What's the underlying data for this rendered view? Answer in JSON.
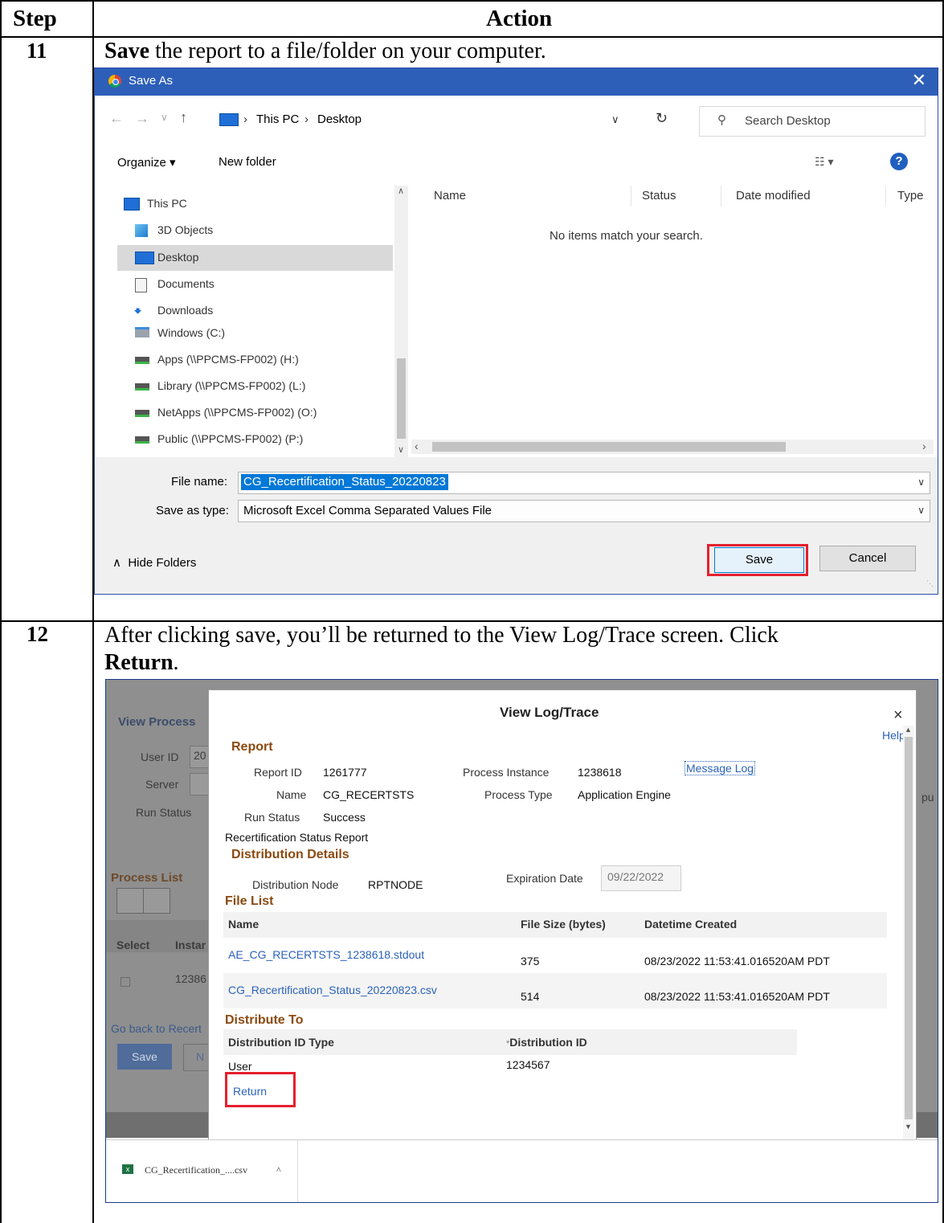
{
  "table": {
    "header_step": "Step",
    "header_action": "Action",
    "rows": [
      {
        "step": "11",
        "bold": "Save",
        "text": " the report to a file/folder on your computer."
      },
      {
        "step": "12",
        "text_line1": "After clicking save, you’ll be returned to the View Log/Trace screen. Click",
        "bold": "Return",
        "after": "."
      }
    ]
  },
  "save_as": {
    "title": "Save As",
    "close": "✕",
    "breadcrumb": [
      "This PC",
      "Desktop"
    ],
    "search_placeholder": "Search Desktop",
    "organize": "Organize ▾",
    "new_folder": "New folder",
    "nav_items": [
      "This PC",
      "3D Objects",
      "Desktop",
      "Documents",
      "Downloads",
      "Windows (C:)",
      "Apps (\\\\PPCMS-FP002) (H:)",
      "Library (\\\\PPCMS-FP002) (L:)",
      "NetApps (\\\\PPCMS-FP002) (O:)",
      "Public (\\\\PPCMS-FP002) (P:)"
    ],
    "columns": [
      "Name",
      "Status",
      "Date modified",
      "Type"
    ],
    "empty_message": "No items match your search.",
    "file_name_label": "File name:",
    "file_name_value": "CG_Recertification_Status_20220823",
    "save_type_label": "Save as type:",
    "save_type_value": "Microsoft Excel Comma Separated Values File",
    "hide_folders": "Hide Folders",
    "save": "Save",
    "cancel": "Cancel",
    "accent": "#2e5fb8"
  },
  "background": {
    "title": "View Process",
    "user_id": "User ID",
    "user_id_value": "20",
    "server": "Server",
    "run_status": "Run Status",
    "process_list": "Process List",
    "col_select": "Select",
    "col_instance": "Instar",
    "instance_value": "12386",
    "go_back": "Go back to Recert",
    "save": "Save",
    "n_btn": "N",
    "edge_text": "pu"
  },
  "view_log": {
    "title": "View Log/Trace",
    "close": "×",
    "help": "Help",
    "report_section": "Report",
    "report_id_label": "Report ID",
    "report_id": "1261777",
    "process_instance_label": "Process Instance",
    "process_instance": "1238618",
    "message_log": "Message Log",
    "name_label": "Name",
    "name": "CG_RECERTSTS",
    "process_type_label": "Process Type",
    "process_type": "Application Engine",
    "run_status_label": "Run Status",
    "run_status": "Success",
    "description": "Recertification Status Report",
    "distribution_section": "Distribution Details",
    "dist_node_label": "Distribution Node",
    "dist_node": "RPTNODE",
    "expiration_label": "Expiration Date",
    "expiration": "09/22/2022",
    "file_list_section": "File List",
    "col_name": "Name",
    "col_size": "File Size (bytes)",
    "col_created": "Datetime Created",
    "files": [
      {
        "name": "AE_CG_RECERTSTS_1238618.stdout",
        "size": "375",
        "created": "08/23/2022 11:53:41.016520AM PDT"
      },
      {
        "name": "CG_Recertification_Status_20220823.csv",
        "size": "514",
        "created": "08/23/2022 11:53:41.016520AM PDT"
      }
    ],
    "distribute_section": "Distribute To",
    "col_dist_type": "Distribution ID Type",
    "col_dist_id": "Distribution ID",
    "required_mark": "*",
    "dist_type": "User",
    "dist_id": "1234567",
    "return": "Return"
  },
  "download_bar": {
    "file": "CG_Recertification_....csv",
    "chevron": "^"
  }
}
